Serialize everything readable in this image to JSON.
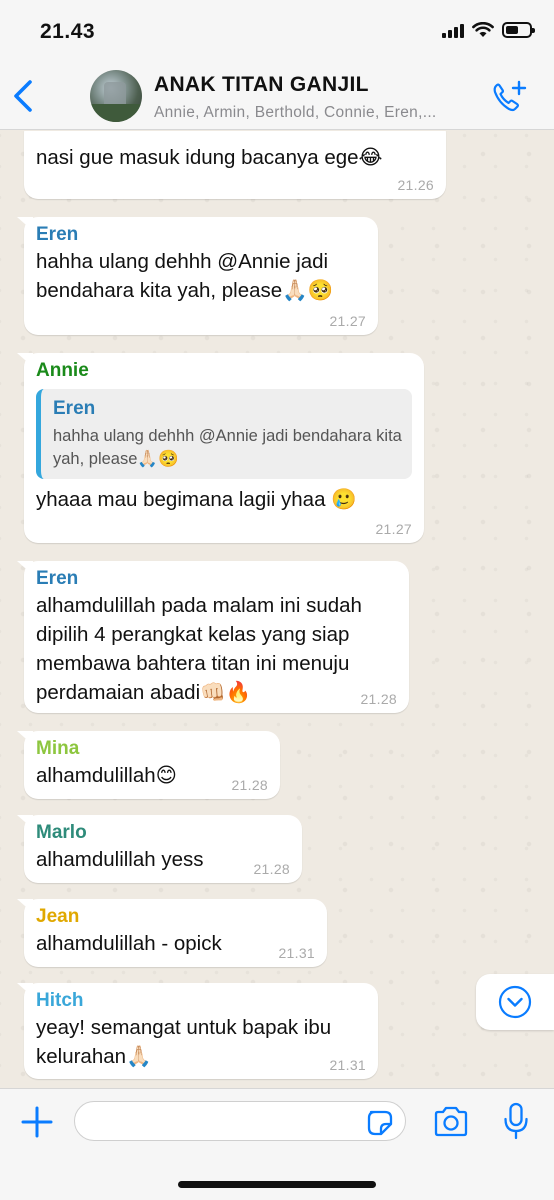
{
  "status_bar": {
    "time": "21.43"
  },
  "header": {
    "title": "ANAK TITAN GANJIL",
    "members": "Annie, Armin, Berthold, Connie, Eren,..."
  },
  "messages": [
    {
      "sender": "",
      "text": "nasi gue masuk idung bacanya ege😂",
      "time": "21.26"
    },
    {
      "sender": "Eren",
      "sender_color": "#2a7db5",
      "text": "hahha ulang dehhh @Annie jadi bendahara kita yah, please🙏🏻🥺",
      "time": "21.27"
    },
    {
      "sender": "Annie",
      "sender_color": "#1a8a1a",
      "quote": {
        "sender": "Eren",
        "text": "hahha ulang dehhh @Annie jadi bendahara kita yah, please🙏🏻🥺"
      },
      "text": "yhaaa mau begimana lagii yhaa 🥲",
      "time": "21.27"
    },
    {
      "sender": "Eren",
      "sender_color": "#2a7db5",
      "text": "alhamdulillah pada malam ini sudah dipilih 4 perangkat kelas yang siap membawa bahtera titan ini menuju perdamaian abadi👊🏻🔥",
      "time": "21.28"
    },
    {
      "sender": "Mina",
      "sender_color": "#8dc63f",
      "text": "alhamdulillah😊",
      "time": "21.28"
    },
    {
      "sender": "Marlo",
      "sender_color": "#2e8b7a",
      "text": "alhamdulillah yess",
      "time": "21.28"
    },
    {
      "sender": "Jean",
      "sender_color": "#e0a800",
      "text": "alhamdulillah - opick",
      "time": "21.31"
    },
    {
      "sender": "Hitch",
      "sender_color": "#3aa7d9",
      "text": "yeay! semangat untuk bapak ibu kelurahan🙏🏻",
      "time": "21.31"
    }
  ],
  "composer": {
    "value": "",
    "placeholder": ""
  },
  "colors": {
    "accent": "#0a7cff",
    "bubble": "#ffffff",
    "chat_bg": "#efeae2"
  },
  "icons": [
    "back-chevron-icon",
    "add-call-icon",
    "scroll-down-icon",
    "plus-icon",
    "sticker-icon",
    "camera-icon",
    "microphone-icon"
  ]
}
